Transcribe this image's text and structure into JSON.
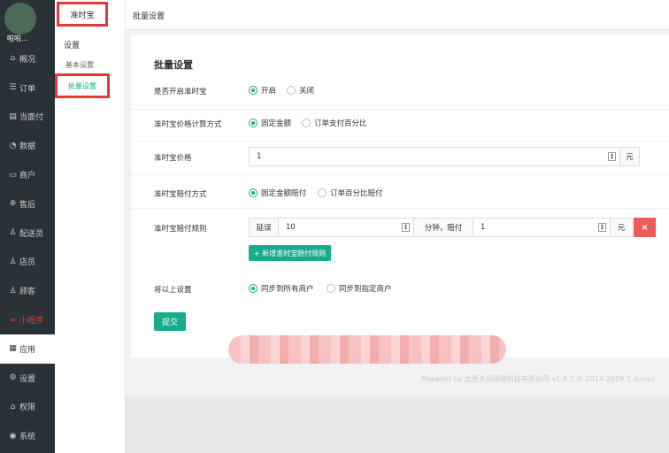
{
  "nav": {
    "user_name": "啦啦...",
    "items": [
      {
        "icon": "home-icon",
        "glyph": "⌂",
        "label": "概况"
      },
      {
        "icon": "order-icon",
        "glyph": "☰",
        "label": "订单"
      },
      {
        "icon": "pay-icon",
        "glyph": "▤",
        "label": "当面付"
      },
      {
        "icon": "data-icon",
        "glyph": "◔",
        "label": "数据"
      },
      {
        "icon": "store-icon",
        "glyph": "▭",
        "label": "商户"
      },
      {
        "icon": "after-sale-icon",
        "glyph": "⊕",
        "label": "售后"
      },
      {
        "icon": "courier-icon",
        "glyph": "♙",
        "label": "配送员"
      },
      {
        "icon": "clerk-icon",
        "glyph": "♙",
        "label": "店员"
      },
      {
        "icon": "customer-icon",
        "glyph": "♙",
        "label": "顾客"
      },
      {
        "icon": "miniprogram-icon",
        "glyph": "∞",
        "label": "小程序"
      },
      {
        "icon": "apps-icon",
        "glyph": "▦",
        "label": "应用"
      },
      {
        "icon": "settings-icon",
        "glyph": "⚙",
        "label": "设置"
      },
      {
        "icon": "permission-icon",
        "glyph": "⌂",
        "label": "权限"
      },
      {
        "icon": "system-icon",
        "glyph": "◉",
        "label": "系统"
      }
    ]
  },
  "subnav": {
    "head": "准时宝",
    "group": "设置",
    "items": [
      "基本设置",
      "批量设置"
    ]
  },
  "topbar": {
    "crumb": "批量设置"
  },
  "form": {
    "title": "批量设置",
    "enable": {
      "label": "是否开启准时宝",
      "options": [
        "开启",
        "关闭"
      ]
    },
    "price_method": {
      "label": "准时宝价格计算方式",
      "options": [
        "固定金额",
        "订单支付百分比"
      ]
    },
    "price": {
      "label": "准时宝价格",
      "value": "1",
      "unit": "元"
    },
    "comp_method": {
      "label": "准时宝赔付方式",
      "options": [
        "固定金额赔付",
        "订单百分比赔付"
      ]
    },
    "rule": {
      "label": "准时宝赔付规则",
      "delay_label": "延误",
      "delay_value": "10",
      "mid_label": "分钟，赔付",
      "pay_value": "1",
      "unit": "元",
      "delete": "×",
      "add_button": "+ 新增准时宝赔付规则"
    },
    "sync": {
      "label": "将以上设置",
      "options": [
        "同步到所有商户",
        "同步到指定商户"
      ]
    },
    "submit": "提交"
  },
  "footer": "Powered by 太原多讯网络科技有限公司 v1.8.2 © 2014-2019 1.duoxu"
}
